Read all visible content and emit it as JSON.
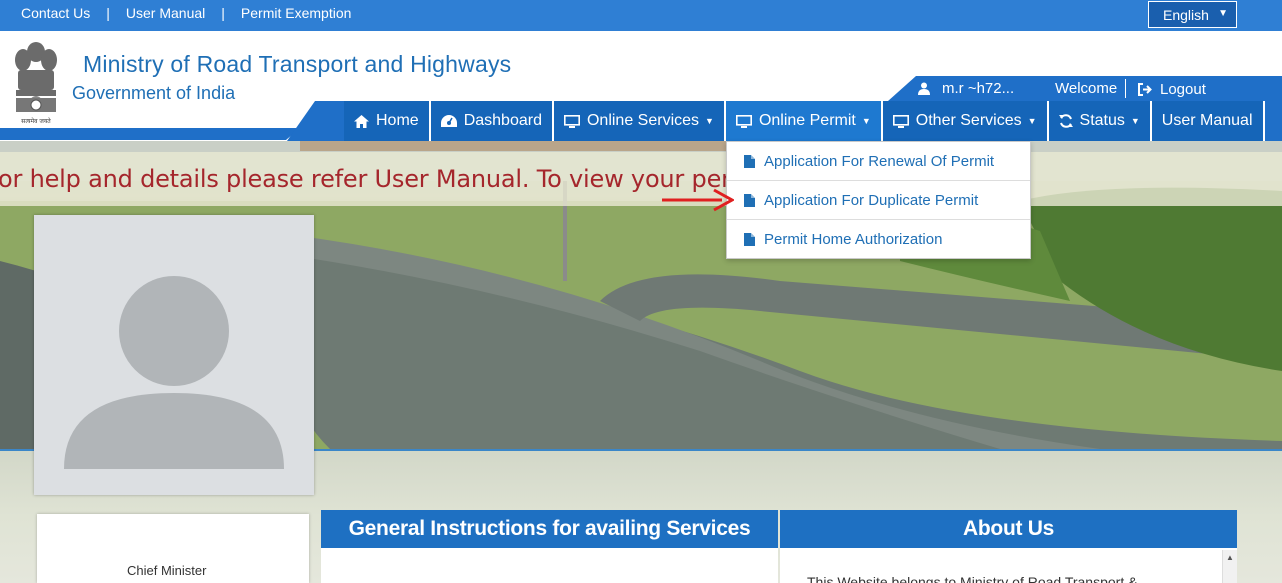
{
  "topbar": {
    "links": [
      "Contact Us",
      "User Manual",
      "Permit Exemption"
    ],
    "separator": "|",
    "language": "English"
  },
  "header": {
    "title": "Ministry of Road Transport and Highways",
    "subtitle": "Government of India",
    "emblem_caption": "सत्यमेव जयते"
  },
  "user": {
    "name": "m.r          ~h72...",
    "welcome": "Welcome",
    "logout": "Logout"
  },
  "nav": [
    {
      "label": "Home",
      "icon": "home-icon"
    },
    {
      "label": "Dashboard",
      "icon": "dashboard-icon"
    },
    {
      "label": "Online Services",
      "icon": "monitor-icon",
      "dropdown": true
    },
    {
      "label": "Online Permit",
      "icon": "monitor-icon",
      "dropdown": true
    },
    {
      "label": "Other Services",
      "icon": "monitor-icon",
      "dropdown": true
    },
    {
      "label": "Status",
      "icon": "refresh-icon",
      "dropdown": true
    },
    {
      "label": "User Manual"
    }
  ],
  "dropdown": {
    "items": [
      "Application For Renewal Of Permit",
      "Application For Duplicate Permit",
      "Permit Home Authorization"
    ],
    "icon": "file-icon"
  },
  "marquee": "or help and details please refer User Manual. To view your pending                                     hboard\".",
  "profile": {
    "role": "Chief Minister"
  },
  "panels": {
    "instructions_title": "General Instructions for availing Services",
    "about_title": "About Us",
    "about_text": "This Website belongs to Ministry of Road Transport &"
  },
  "colors": {
    "primary": "#1f6fc8",
    "topbar": "#2f7fd4",
    "marquee_text": "#a5262c",
    "arrow": "#e02020"
  }
}
